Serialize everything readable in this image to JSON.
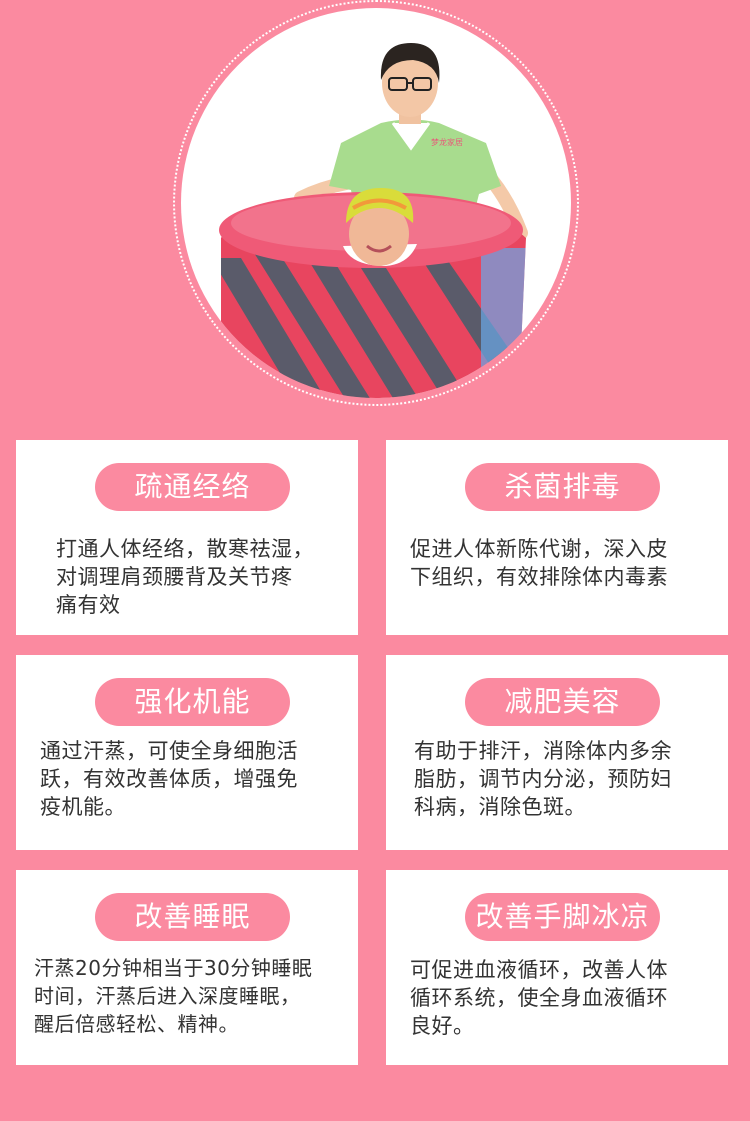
{
  "colors": {
    "background": "#fb8aa0",
    "card": "#ffffff",
    "pill": "#fb8aa0",
    "pill_text": "#ffffff",
    "desc_text": "#333333"
  },
  "hero": {
    "image": "photo-person-in-pink-steam-sauna",
    "shirt_logo_text": "梦龙家居"
  },
  "cards": [
    {
      "title": "疏通经络",
      "desc": "打通人体经络，散寒祛湿，\n对调理肩颈腰背及关节疼\n痛有效"
    },
    {
      "title": "杀菌排毒",
      "desc": "促进人体新陈代谢，深入皮\n下组织，有效排除体内毒素"
    },
    {
      "title": "强化机能",
      "desc": "通过汗蒸，可使全身细胞活\n跃，有效改善体质，增强免\n疫机能。"
    },
    {
      "title": "减肥美容",
      "desc": "有助于排汗，消除体内多余\n脂肪，调节内分泌，预防妇\n科病，消除色斑。"
    },
    {
      "title": "改善睡眠",
      "desc": "汗蒸20分钟相当于30分钟睡眠\n时间，汗蒸后进入深度睡眠，\n醒后倍感轻松、精神。"
    },
    {
      "title": "改善手脚冰凉",
      "desc": "可促进血液循环，改善人体\n循环系统，使全身血液循环\n良好。"
    }
  ]
}
